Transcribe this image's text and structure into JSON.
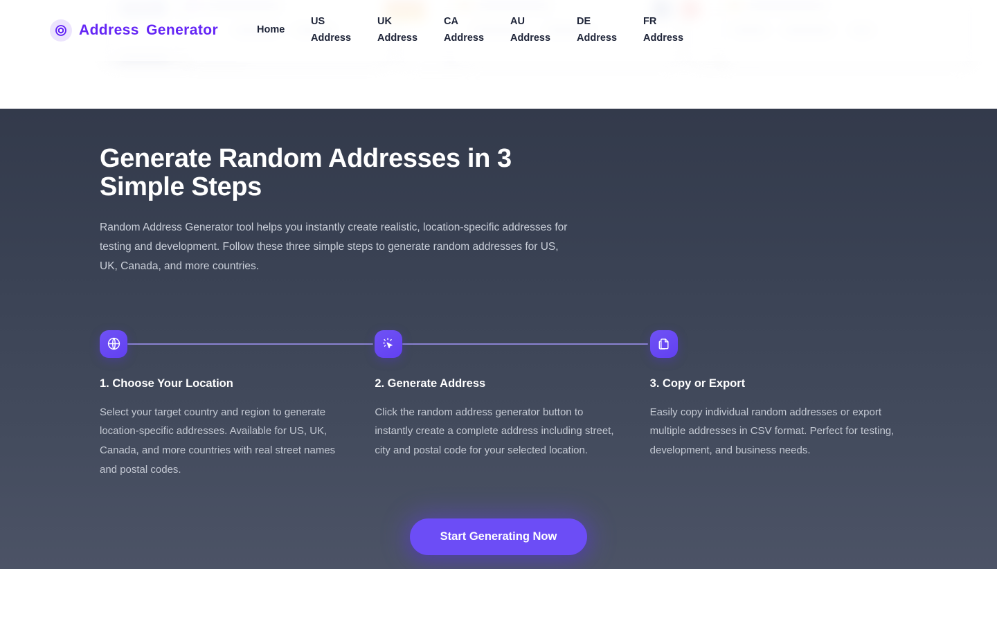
{
  "brand": {
    "name": "Address  Generator",
    "logo_icon": "location-target-icon",
    "accent_color": "#6425f5",
    "logo_bg_color": "#ece4fd"
  },
  "nav": {
    "items": [
      {
        "label": "Home",
        "name": "nav-item-home"
      },
      {
        "label": "US\nAddress",
        "name": "nav-item-us-address"
      },
      {
        "label": "UK\nAddress",
        "name": "nav-item-uk-address"
      },
      {
        "label": "CA\nAddress",
        "name": "nav-item-ca-address"
      },
      {
        "label": "AU\nAddress",
        "name": "nav-item-au-address"
      },
      {
        "label": "DE\nAddress",
        "name": "nav-item-de-address"
      },
      {
        "label": "FR\nAddress",
        "name": "nav-item-fr-address"
      }
    ]
  },
  "hero": {
    "title": "Generate Random Addresses in 3\nSimple Steps",
    "subtitle": "Random Address Generator tool helps you instantly create realistic, location-specific addresses for testing and development. Follow these three simple steps to generate random addresses for US, UK, Canada, and more countries."
  },
  "steps": [
    {
      "icon": "globe-icon",
      "title": "1. Choose Your Location",
      "description": "Select your target country and region to generate location-specific addresses. Available for US, UK, Canada, and more countries with real street names and postal codes."
    },
    {
      "icon": "magic-cursor-icon",
      "title": "2. Generate Address",
      "description": "Click the random address generator button to instantly create a complete address including street, city and postal code for your selected location."
    },
    {
      "icon": "copy-documents-icon",
      "title": "3. Copy or Export",
      "description": "Easily copy individual random addresses or export multiple addresses in CSV format. Perfect for testing, development, and business needs."
    }
  ],
  "cta": {
    "label": "Start Generating Now",
    "color": "#6c4df6"
  },
  "theme": {
    "section_bg_top": "#333a4b",
    "section_bg_bottom": "#4c5366",
    "step_icon_bg": "#6240f2",
    "connector_color": "#8a83d1"
  }
}
